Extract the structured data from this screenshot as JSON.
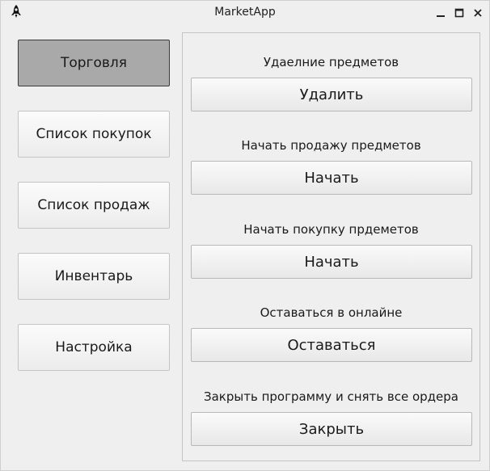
{
  "window": {
    "title": "MarketApp",
    "icons": {
      "app": "rocket-icon",
      "minimize": "minimize-icon",
      "maximize": "maximize-icon",
      "close": "close-icon"
    }
  },
  "sidebar": {
    "items": [
      {
        "label": "Торговля",
        "active": true
      },
      {
        "label": "Список покупок",
        "active": false
      },
      {
        "label": "Список продаж",
        "active": false
      },
      {
        "label": "Инвентарь",
        "active": false
      },
      {
        "label": "Настройка",
        "active": false
      }
    ]
  },
  "main": {
    "sections": [
      {
        "label": "Удаелние предметов",
        "button": "Удалить"
      },
      {
        "label": "Начать продажу предметов",
        "button": "Начать"
      },
      {
        "label": "Начать покупку прдеметов",
        "button": "Начать"
      },
      {
        "label": "Оставаться в онлайне",
        "button": "Оставаться"
      },
      {
        "label": "Закрыть программу и снять все ордера",
        "button": "Закрыть"
      }
    ]
  },
  "colors": {
    "background": "#efefef",
    "active_nav": "#a9a9a9"
  }
}
